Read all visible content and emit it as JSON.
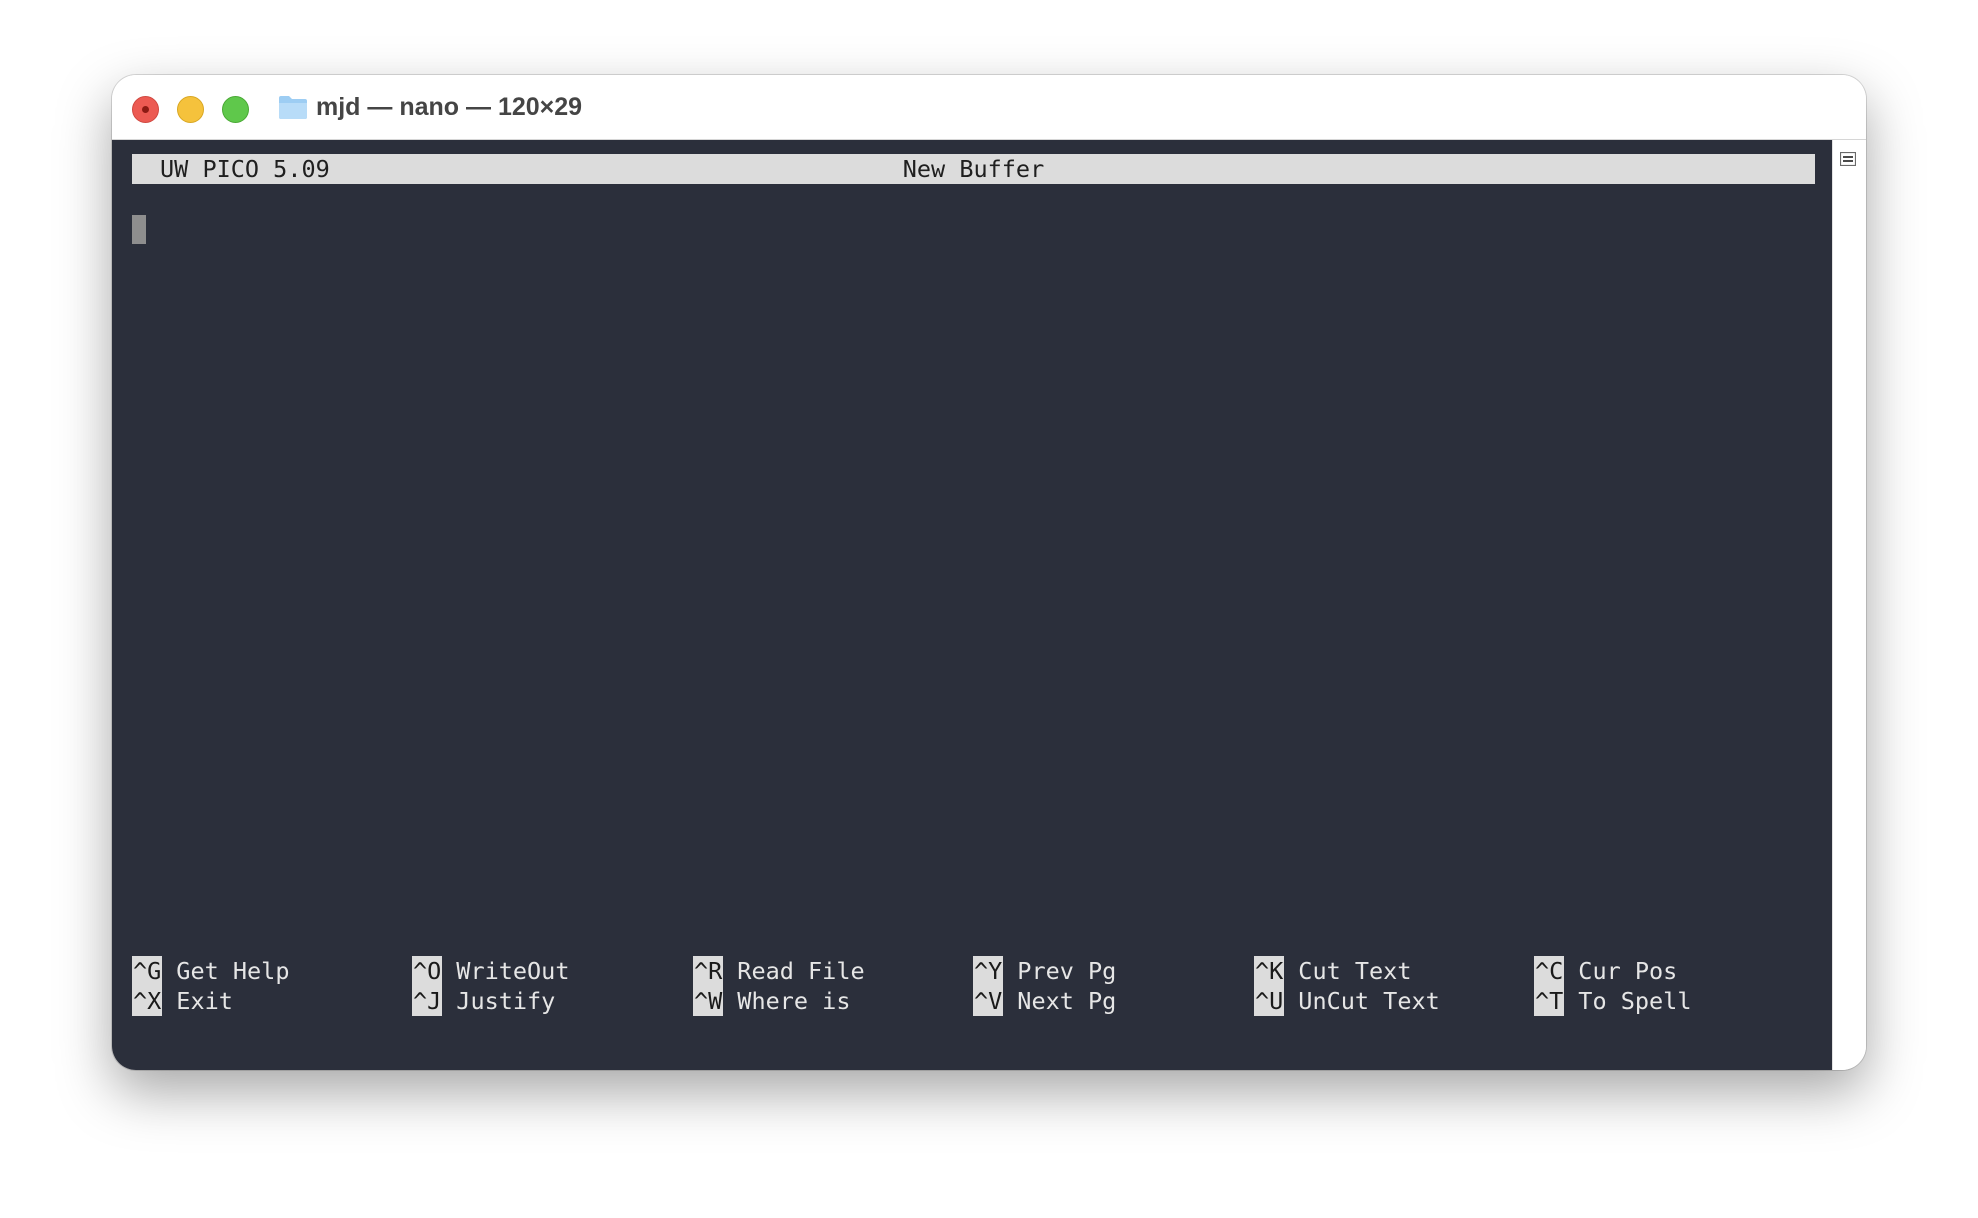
{
  "window": {
    "title": "mjd — nano — 120×29"
  },
  "editor": {
    "app_name": "UW PICO 5.09",
    "buffer_name": "New Buffer"
  },
  "shortcuts": [
    {
      "key": "^G",
      "label": "Get Help"
    },
    {
      "key": "^X",
      "label": "Exit"
    },
    {
      "key": "^O",
      "label": "WriteOut"
    },
    {
      "key": "^J",
      "label": "Justify"
    },
    {
      "key": "^R",
      "label": "Read File"
    },
    {
      "key": "^W",
      "label": "Where is"
    },
    {
      "key": "^Y",
      "label": "Prev Pg"
    },
    {
      "key": "^V",
      "label": "Next Pg"
    },
    {
      "key": "^K",
      "label": "Cut Text"
    },
    {
      "key": "^U",
      "label": "UnCut Text"
    },
    {
      "key": "^C",
      "label": "Cur Pos"
    },
    {
      "key": "^T",
      "label": "To Spell"
    }
  ],
  "colors": {
    "terminal_background": "#2b2f3b",
    "inverse_bar": "#dcdcdc",
    "close": "#ec5a52",
    "minimize": "#f5c23c",
    "maximize": "#5fc84b"
  },
  "icons": [
    "folder-icon",
    "scroll-menu-icon"
  ]
}
